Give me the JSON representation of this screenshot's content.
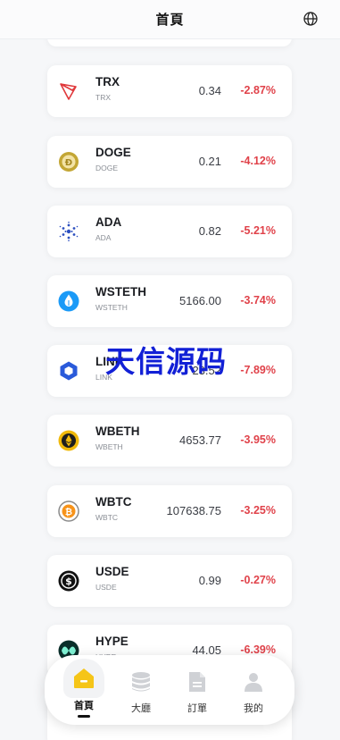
{
  "header": {
    "title": "首頁",
    "globe_icon": "globe-icon"
  },
  "coins": [
    {
      "symbol": "TRX",
      "name": "TRX",
      "price": "0.34",
      "change": "-2.87%",
      "icon": "tron-icon",
      "color": "#e0383b"
    },
    {
      "symbol": "DOGE",
      "name": "DOGE",
      "price": "0.21",
      "change": "-4.12%",
      "icon": "doge-icon",
      "color": "#c3a634"
    },
    {
      "symbol": "ADA",
      "name": "ADA",
      "price": "0.82",
      "change": "-5.21%",
      "icon": "cardano-icon",
      "color": "#2c4fbf"
    },
    {
      "symbol": "WSTETH",
      "name": "WSTETH",
      "price": "5166.00",
      "change": "-3.74%",
      "icon": "wsteth-icon",
      "color": "#1b9af7"
    },
    {
      "symbol": "LINK",
      "name": "LINK",
      "price": "23.52",
      "change": "-7.89%",
      "icon": "chainlink-icon",
      "color": "#2a5ada"
    },
    {
      "symbol": "WBETH",
      "name": "WBETH",
      "price": "4653.77",
      "change": "-3.95%",
      "icon": "wbeth-icon",
      "color": "#f0b90b"
    },
    {
      "symbol": "WBTC",
      "name": "WBTC",
      "price": "107638.75",
      "change": "-3.25%",
      "icon": "wbtc-icon",
      "color": "#8a8a8a"
    },
    {
      "symbol": "USDE",
      "name": "USDE",
      "price": "0.99",
      "change": "-0.27%",
      "icon": "usde-icon",
      "color": "#111111"
    },
    {
      "symbol": "HYPE",
      "name": "HYPE",
      "price": "44.05",
      "change": "-6.39%",
      "icon": "hype-icon",
      "color": "#0a2e2a"
    }
  ],
  "watermark": "天信源码",
  "tabbar": {
    "tabs": [
      {
        "label": "首頁",
        "icon": "home-icon",
        "active": true
      },
      {
        "label": "大廳",
        "icon": "database-icon",
        "active": false
      },
      {
        "label": "訂單",
        "icon": "document-icon",
        "active": false
      },
      {
        "label": "我的",
        "icon": "user-icon",
        "active": false
      }
    ]
  },
  "colors": {
    "negative": "#e0424a",
    "accent": "#f5c518"
  }
}
